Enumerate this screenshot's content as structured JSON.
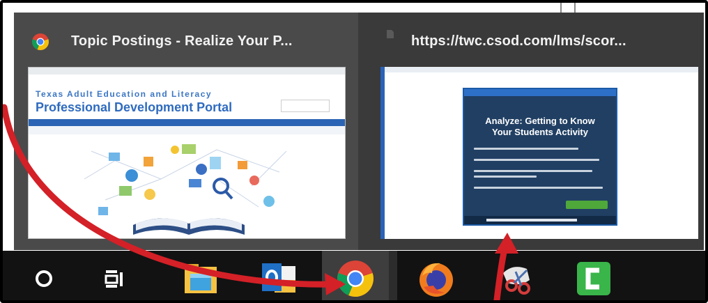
{
  "thumbnails": [
    {
      "title": "Topic Postings - Realize Your P...",
      "icon": "chrome-icon",
      "preview": {
        "subtitle": "Texas Adult Education and Literacy",
        "heading": "Professional Development Portal"
      }
    },
    {
      "title": "https://twc.csod.com/lms/scor...",
      "icon": "page-icon",
      "preview": {
        "course_title_line1": "Analyze: Getting to Know",
        "course_title_line2": "Your Students Activity"
      }
    }
  ],
  "taskbar": {
    "items": [
      {
        "name": "cortana-icon"
      },
      {
        "name": "task-view-icon"
      },
      {
        "name": "file-explorer-icon"
      },
      {
        "name": "outlook-icon"
      },
      {
        "name": "chrome-icon",
        "active": true
      },
      {
        "name": "firefox-icon"
      },
      {
        "name": "snipping-tool-icon"
      },
      {
        "name": "camtasia-icon"
      }
    ]
  },
  "colors": {
    "arrow": "#d42027",
    "taskbar": "#121212",
    "popup": "#3d3d3d",
    "portal_blue": "#2f6bbf",
    "camtasia_green": "#39b54a"
  }
}
